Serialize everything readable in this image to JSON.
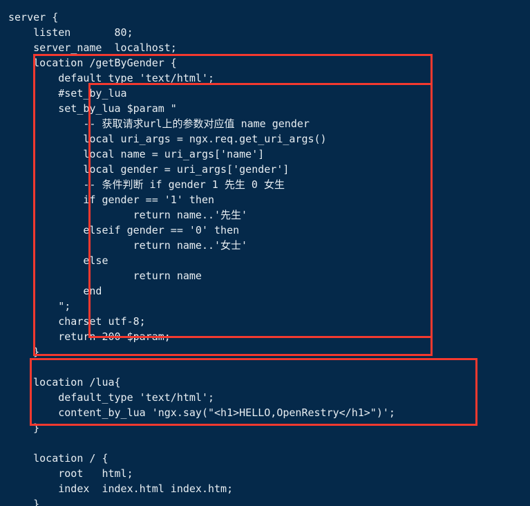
{
  "editor": {
    "language": "nginx-conf",
    "background_color": "#05294a",
    "text_color": "#e8eef2",
    "highlight_color": "#f4392f",
    "code": "server {\n    listen       80;\n    server_name  localhost;\n    location /getByGender {\n        default_type 'text/html';\n        #set_by_lua\n        set_by_lua $param \"\n            -- 获取请求url上的参数对应值 name gender\n            local uri_args = ngx.req.get_uri_args()\n            local name = uri_args['name']\n            local gender = uri_args['gender']\n            -- 条件判断 if gender 1 先生 0 女生\n            if gender == '1' then\n                    return name..'先生'\n            elseif gender == '0' then\n                    return name..'女士'\n            else\n                    return name\n            end\n        \";\n        charset utf-8;\n        return 200 $param;\n    }\n\n    location /lua{\n        default_type 'text/html';\n        content_by_lua 'ngx.say(\"<h1>HELLO,OpenRestry</h1>\")';\n    }\n\n    location / {\n        root   html;\n        index  index.html index.htm;\n    }\n"
  },
  "highlights": [
    {
      "id": "box-outer",
      "label": "location-getbygender-block-highlight",
      "target_text": "location /getByGender { ... }"
    },
    {
      "id": "box-inner",
      "label": "set-by-lua-directive-highlight",
      "target_text": "#set_by_lua ... return 200 $param;"
    },
    {
      "id": "box-lua",
      "label": "location-lua-block-highlight",
      "target_text": "location /lua{ ... }"
    }
  ]
}
